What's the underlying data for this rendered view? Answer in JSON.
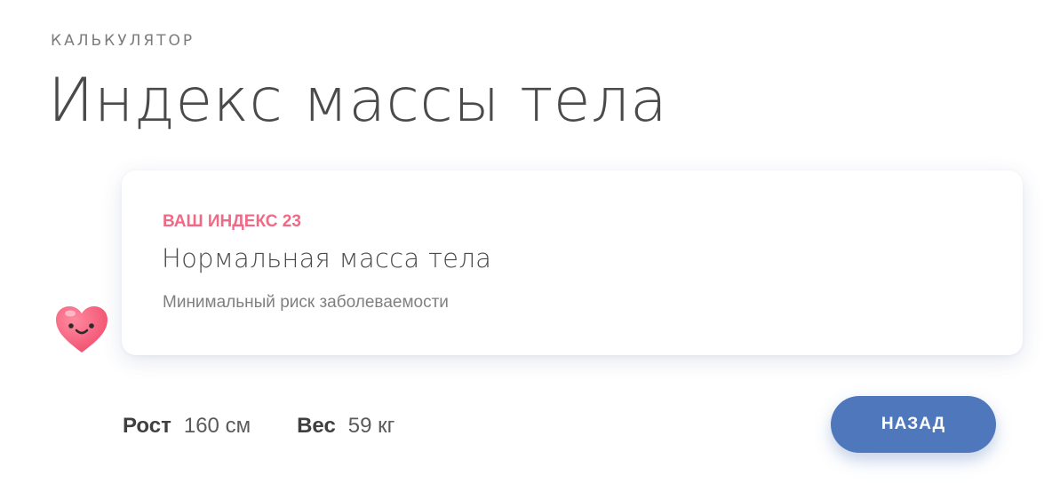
{
  "header": {
    "eyebrow": "КАЛЬКУЛЯТОР",
    "title": "Индекс массы тела"
  },
  "result": {
    "index_label": "ВАШ ИНДЕКС 23",
    "title": "Нормальная масса тела",
    "description": "Минимальный риск заболеваемости"
  },
  "mascot": {
    "icon": "heart-smile-icon"
  },
  "stats": {
    "height_label": "Рост",
    "height_value": "160 см",
    "weight_label": "Вес",
    "weight_value": "59 кг"
  },
  "actions": {
    "back_label": "НАЗАД"
  },
  "colors": {
    "accent_pink": "#f06a86",
    "button_blue": "#4f78bc",
    "text_dark": "#4a4a4a",
    "text_muted": "#808080"
  }
}
